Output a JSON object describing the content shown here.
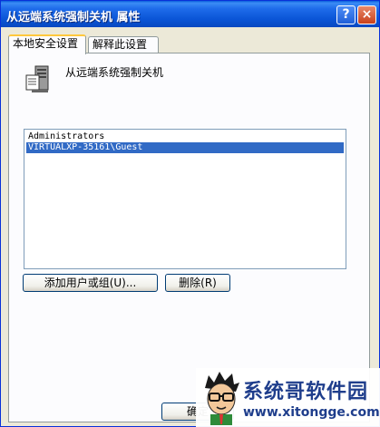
{
  "window": {
    "title": "从远端系统强制关机 属性",
    "help_label": "?",
    "close_label": "×"
  },
  "tabs": [
    {
      "label": "本地安全设置",
      "active": true
    },
    {
      "label": "解释此设置",
      "active": false
    }
  ],
  "policy": {
    "icon": "policy-server-icon",
    "title": "从远端系统强制关机"
  },
  "accounts": [
    {
      "name": "Administrators",
      "selected": false
    },
    {
      "name": "VIRTUALXP-35161\\Guest",
      "selected": true
    }
  ],
  "buttons": {
    "add": "添加用户或组(U)...",
    "remove": "删除(R)",
    "ok": "确定"
  },
  "watermark": {
    "name": "系统哥软件园",
    "url": "www.xitongge.com"
  },
  "colors": {
    "titlebar": "#0a55d6",
    "selection": "#316ac5",
    "tab_highlight": "#ffc83c",
    "watermark_text": "#1f3e8c"
  }
}
